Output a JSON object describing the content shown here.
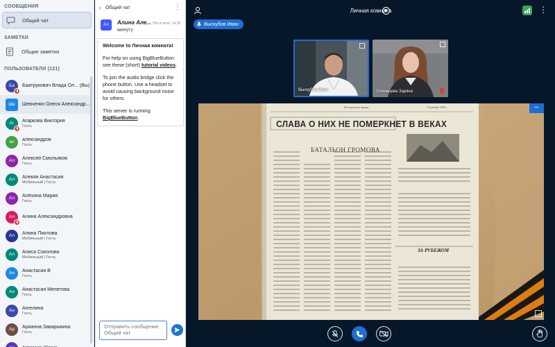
{
  "sidebar": {
    "messages_title": "СООБЩЕНИЯ",
    "public_chat_label": "Общий чат",
    "notes_title": "ЗАМЕТКИ",
    "shared_notes_label": "Общие заметки",
    "users_title": "ПОЛЬЗОВАТЕЛИ (121)"
  },
  "users": [
    {
      "initials": "Ба",
      "name": "Баатрукович Влада Ол... (Вы)",
      "role": "",
      "color": "#3949ab",
      "square": false,
      "mic": true
    },
    {
      "initials": "Ше",
      "name": "Шевченко Олеся Александр...",
      "role": "",
      "color": "#1e88e5",
      "square": true,
      "mic": false
    },
    {
      "initials": "Аг",
      "name": "Агаркова Виктория",
      "role": "Гость",
      "color": "#00897b",
      "square": false,
      "mic": true
    },
    {
      "initials": "ал",
      "name": "александров",
      "role": "Гость",
      "color": "#43a047",
      "square": false,
      "mic": false
    },
    {
      "initials": "Ал",
      "name": "Алексей Смольяков",
      "role": "Гость",
      "color": "#8e24aa",
      "square": false,
      "mic": false
    },
    {
      "initials": "Ал",
      "name": "Алекян Анастасия",
      "role": "Мобильный | Гость",
      "color": "#00897b",
      "square": false,
      "mic": false
    },
    {
      "initials": "Ал",
      "name": "Алёхина Мария",
      "role": "Гость",
      "color": "#8e24aa",
      "square": false,
      "mic": false
    },
    {
      "initials": "Ал",
      "name": "Алина Александровна",
      "role": "",
      "color": "#d81b60",
      "square": false,
      "mic": true
    },
    {
      "initials": "Ал",
      "name": "Алина Пихлова",
      "role": "Мобильный | Гость",
      "color": "#283593",
      "square": false,
      "mic": false
    },
    {
      "initials": "Ал",
      "name": "Алиса Соколова",
      "role": "Мобильный | Гость",
      "color": "#00897b",
      "square": false,
      "mic": false
    },
    {
      "initials": "Ан",
      "name": "Анастасия В",
      "role": "Гость",
      "color": "#1e88e5",
      "square": false,
      "mic": false
    },
    {
      "initials": "Ан",
      "name": "Анастасия Мелетова",
      "role": "Гость",
      "color": "#00897b",
      "square": false,
      "mic": false
    },
    {
      "initials": "Ан",
      "name": "Ангелина",
      "role": "Гость",
      "color": "#3949ab",
      "square": false,
      "mic": false
    },
    {
      "initials": "Ар",
      "name": "Арианна Заварыкина",
      "role": "Гость",
      "color": "#6d4c41",
      "square": false,
      "mic": false
    },
    {
      "initials": "Ар",
      "name": "Артемий (Стас)",
      "role": "",
      "color": "#5e35b1",
      "square": false,
      "mic": false
    }
  ],
  "chat": {
    "back_label": "Общий чат",
    "message": {
      "initials": "Ал",
      "author": "Алина Але...",
      "meta": "(Не в сети)",
      "time": "14:30",
      "text": "минуту"
    },
    "welcome": {
      "title": "Welcome to Личная комната!",
      "help_prefix": "For help on using BigBlueButton see these (short) ",
      "help_link": "tutorial videos",
      "help_suffix": ".",
      "audio": "To join the audio bridge click the phone button. Use a headset to avoid causing background noise for others.",
      "server_prefix": "This server is running ",
      "server_link": "BigBlueButton",
      "server_suffix": "."
    },
    "input_placeholder": "Отправить сообщение Общий чат"
  },
  "header": {
    "room_title": "Личная комната",
    "talking_user": "Выскубов Иван"
  },
  "videos": [
    {
      "name": "Выскубов Иван"
    },
    {
      "name": "Оленицева Заряна"
    }
  ],
  "newspaper": {
    "masthead": "Белгородская правда",
    "date": "9 декабря 1948 г.",
    "headline": "СЛАВА О НИХ НЕ ПОМЕРКНЕТ В ВЕКАХ",
    "article_title": "БАТАЛЬОН ГРОМОВА",
    "right_heading": "ЗА РУБЕЖОМ"
  },
  "colors": {
    "accent": "#1f6fd1",
    "mic_muted": "#e53935",
    "connection": "#3aa655",
    "background": "#06172a"
  },
  "icons": {
    "chat": "chat-bubble-icon",
    "notes": "notes-icon",
    "mute": "mic-muted-icon",
    "phone": "phone-icon",
    "camera": "camera-off-icon",
    "hand": "raise-hand-icon"
  }
}
